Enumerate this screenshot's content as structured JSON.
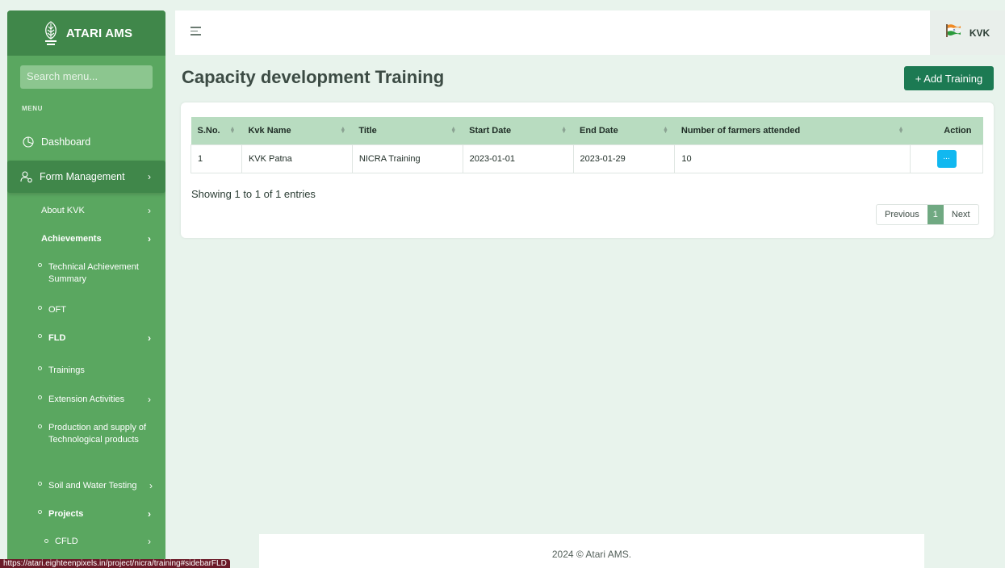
{
  "app": {
    "brand_name": "ATARI AMS",
    "search_placeholder": "Search menu..."
  },
  "sidebar": {
    "menu_title": "MENU",
    "dashboard": "Dashboard",
    "form_management": "Form Management",
    "about_kvk": "About KVK",
    "achievements": "Achievements",
    "technical_achievement_summary": "Technical Achievement Summary",
    "oft": "OFT",
    "fld": "FLD",
    "trainings": "Trainings",
    "extension_activities": "Extension Activities",
    "production_supply": "Production and supply of Technological products",
    "soil_water_testing": "Soil and Water Testing",
    "projects": "Projects",
    "cfld": "CFLD"
  },
  "header": {
    "user_label": "KVK"
  },
  "page": {
    "title": "Capacity development Training",
    "add_button": "+ Add Training"
  },
  "table": {
    "columns": [
      "S.No.",
      "Kvk Name",
      "Title",
      "Start Date",
      "End Date",
      "Number of farmers attended",
      "Action"
    ],
    "rows": [
      [
        "1",
        "KVK Patna",
        "NICRA Training",
        "2023-01-01",
        "2023-01-29",
        "10"
      ]
    ],
    "action_label": "...",
    "entries_text": "Showing 1 to 1 of 1 entries",
    "pagination": {
      "previous": "Previous",
      "current": "1",
      "next": "Next"
    }
  },
  "footer": {
    "text": "2024 © Atari AMS."
  },
  "status_url": "https://atari.eighteenpixels.in/project/nicra/training#sidebarFLD",
  "colors": {
    "sidebar": "#5aa760",
    "sidebar_active": "#40874a",
    "primary_button": "#1c7a53",
    "table_header": "#b8dcc0",
    "action_button": "#11b8f0"
  }
}
